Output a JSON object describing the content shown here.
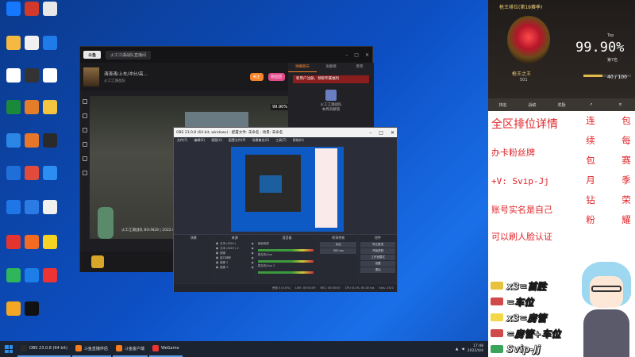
{
  "desktop": {
    "icon_colors": [
      "#1677ff",
      "#d0392b",
      "#e8e8e8",
      "#f5b942",
      "#f0f0f0",
      "#1f7be8",
      "#ffffff",
      "#333333",
      "#ffffff",
      "#1a8a3a",
      "#e37d2a",
      "#f5c542",
      "#2b86e6",
      "#e8762a",
      "#2a2a2a",
      "#1f6fd8",
      "#e14b3b",
      "#2b8ef0",
      "#1f76e6",
      "#2c7be5",
      "#f0f0f0",
      "#e3342f",
      "#f26b21",
      "#f5d223",
      "#2fb55a",
      "#1d7ee8",
      "#e33",
      "#f5a623",
      "#111111"
    ]
  },
  "taskbar": {
    "items": [
      {
        "label": "OBS 23.0.8 (64 bit)",
        "color": "#2a2a2a"
      },
      {
        "label": "斗鱼直播伴侣",
        "color": "#f57c1f"
      },
      {
        "label": "斗鱼客户端",
        "color": "#f57c1f"
      },
      {
        "label": "WeGame",
        "color": "#e33"
      }
    ],
    "time": "17:48",
    "date": "2022/4/4"
  },
  "app_window": {
    "logo": "斗鱼",
    "tab_label": "火工江湖战队直播间",
    "streamer_name": "涛涛涛/上车/冲分/高...",
    "streamer_sub": "火工江湖战队",
    "follow_btn": "关注",
    "gift_btn": "粉丝团",
    "chat_tabs": [
      "弹幕聊天",
      "贡献榜",
      "贵宾"
    ],
    "red_banner": "新用户注册，领取专属福利",
    "gift_title": "火工江湖战队",
    "gift_sub": "本周贡献值",
    "video_score": "99.90%",
    "video_hud": "火工江湖战队 BO:IN28 | 2022.04.04"
  },
  "obs": {
    "title": "OBS 23.0.8 (64 bit, windows) - 配置文件: 未命名 - 场景: 未命名",
    "menu": [
      "文件(F)",
      "编辑(E)",
      "视图(V)",
      "配置文件(P)",
      "场景集合(S)",
      "工具(T)",
      "帮助(H)"
    ],
    "docks": {
      "scenes": "场景",
      "sources": "来源",
      "mixer": "混音器",
      "transitions": "转场特效",
      "controls": "控件"
    },
    "sources_list": [
      "文本 (GDI+)",
      "文本 (GDI+) 2",
      "图像",
      "窗口捕获",
      "图像 2",
      "图像 3"
    ],
    "mixer_channels": [
      "桌面音频",
      "麦克风/Aux",
      "麦克风/Aux 2"
    ],
    "transition": "淡出",
    "duration": "300 ms",
    "controls_buttons": [
      "停止推流",
      "开始录制",
      "工作室模式",
      "设置",
      "退出"
    ],
    "status": [
      "丢帧 0 (0.0%)",
      "LIVE: 00:54:09",
      "REC: 00:00:00",
      "CPU: 8.2%, 60.00 fps",
      "kb/s: 2521"
    ]
  },
  "rank": {
    "title": "枪王排位(第18赛季)",
    "rank_name": "枪王之王",
    "points": "501",
    "top_label": "Top",
    "percent": "99.90%",
    "rank_no": "第7名",
    "progress_text": "40 / 100",
    "progress": 0.4,
    "tabs": [
      "排名",
      "战绩",
      "奖励"
    ]
  },
  "overlay": {
    "header": "全区排位详情",
    "lines": [
      "办卡粉丝牌",
      "+V: Svip-Jj",
      "账号实名是自己",
      "可以刷人脸认证"
    ],
    "col1": "连\n续\n包\n月\n钻\n粉",
    "col2": "包\n每\n赛\n季\n荣\n耀"
  },
  "perks": [
    {
      "label": "x3=首胜",
      "color": "#e8c23a"
    },
    {
      "label": "=车位",
      "color": "#d04a4a"
    },
    {
      "label": "x3=房管",
      "color": "#f5d84a"
    },
    {
      "label": "=房管+车位",
      "color": "#d04a4a"
    },
    {
      "label": "Svip-Jj",
      "color": "#3aa55a"
    }
  ]
}
